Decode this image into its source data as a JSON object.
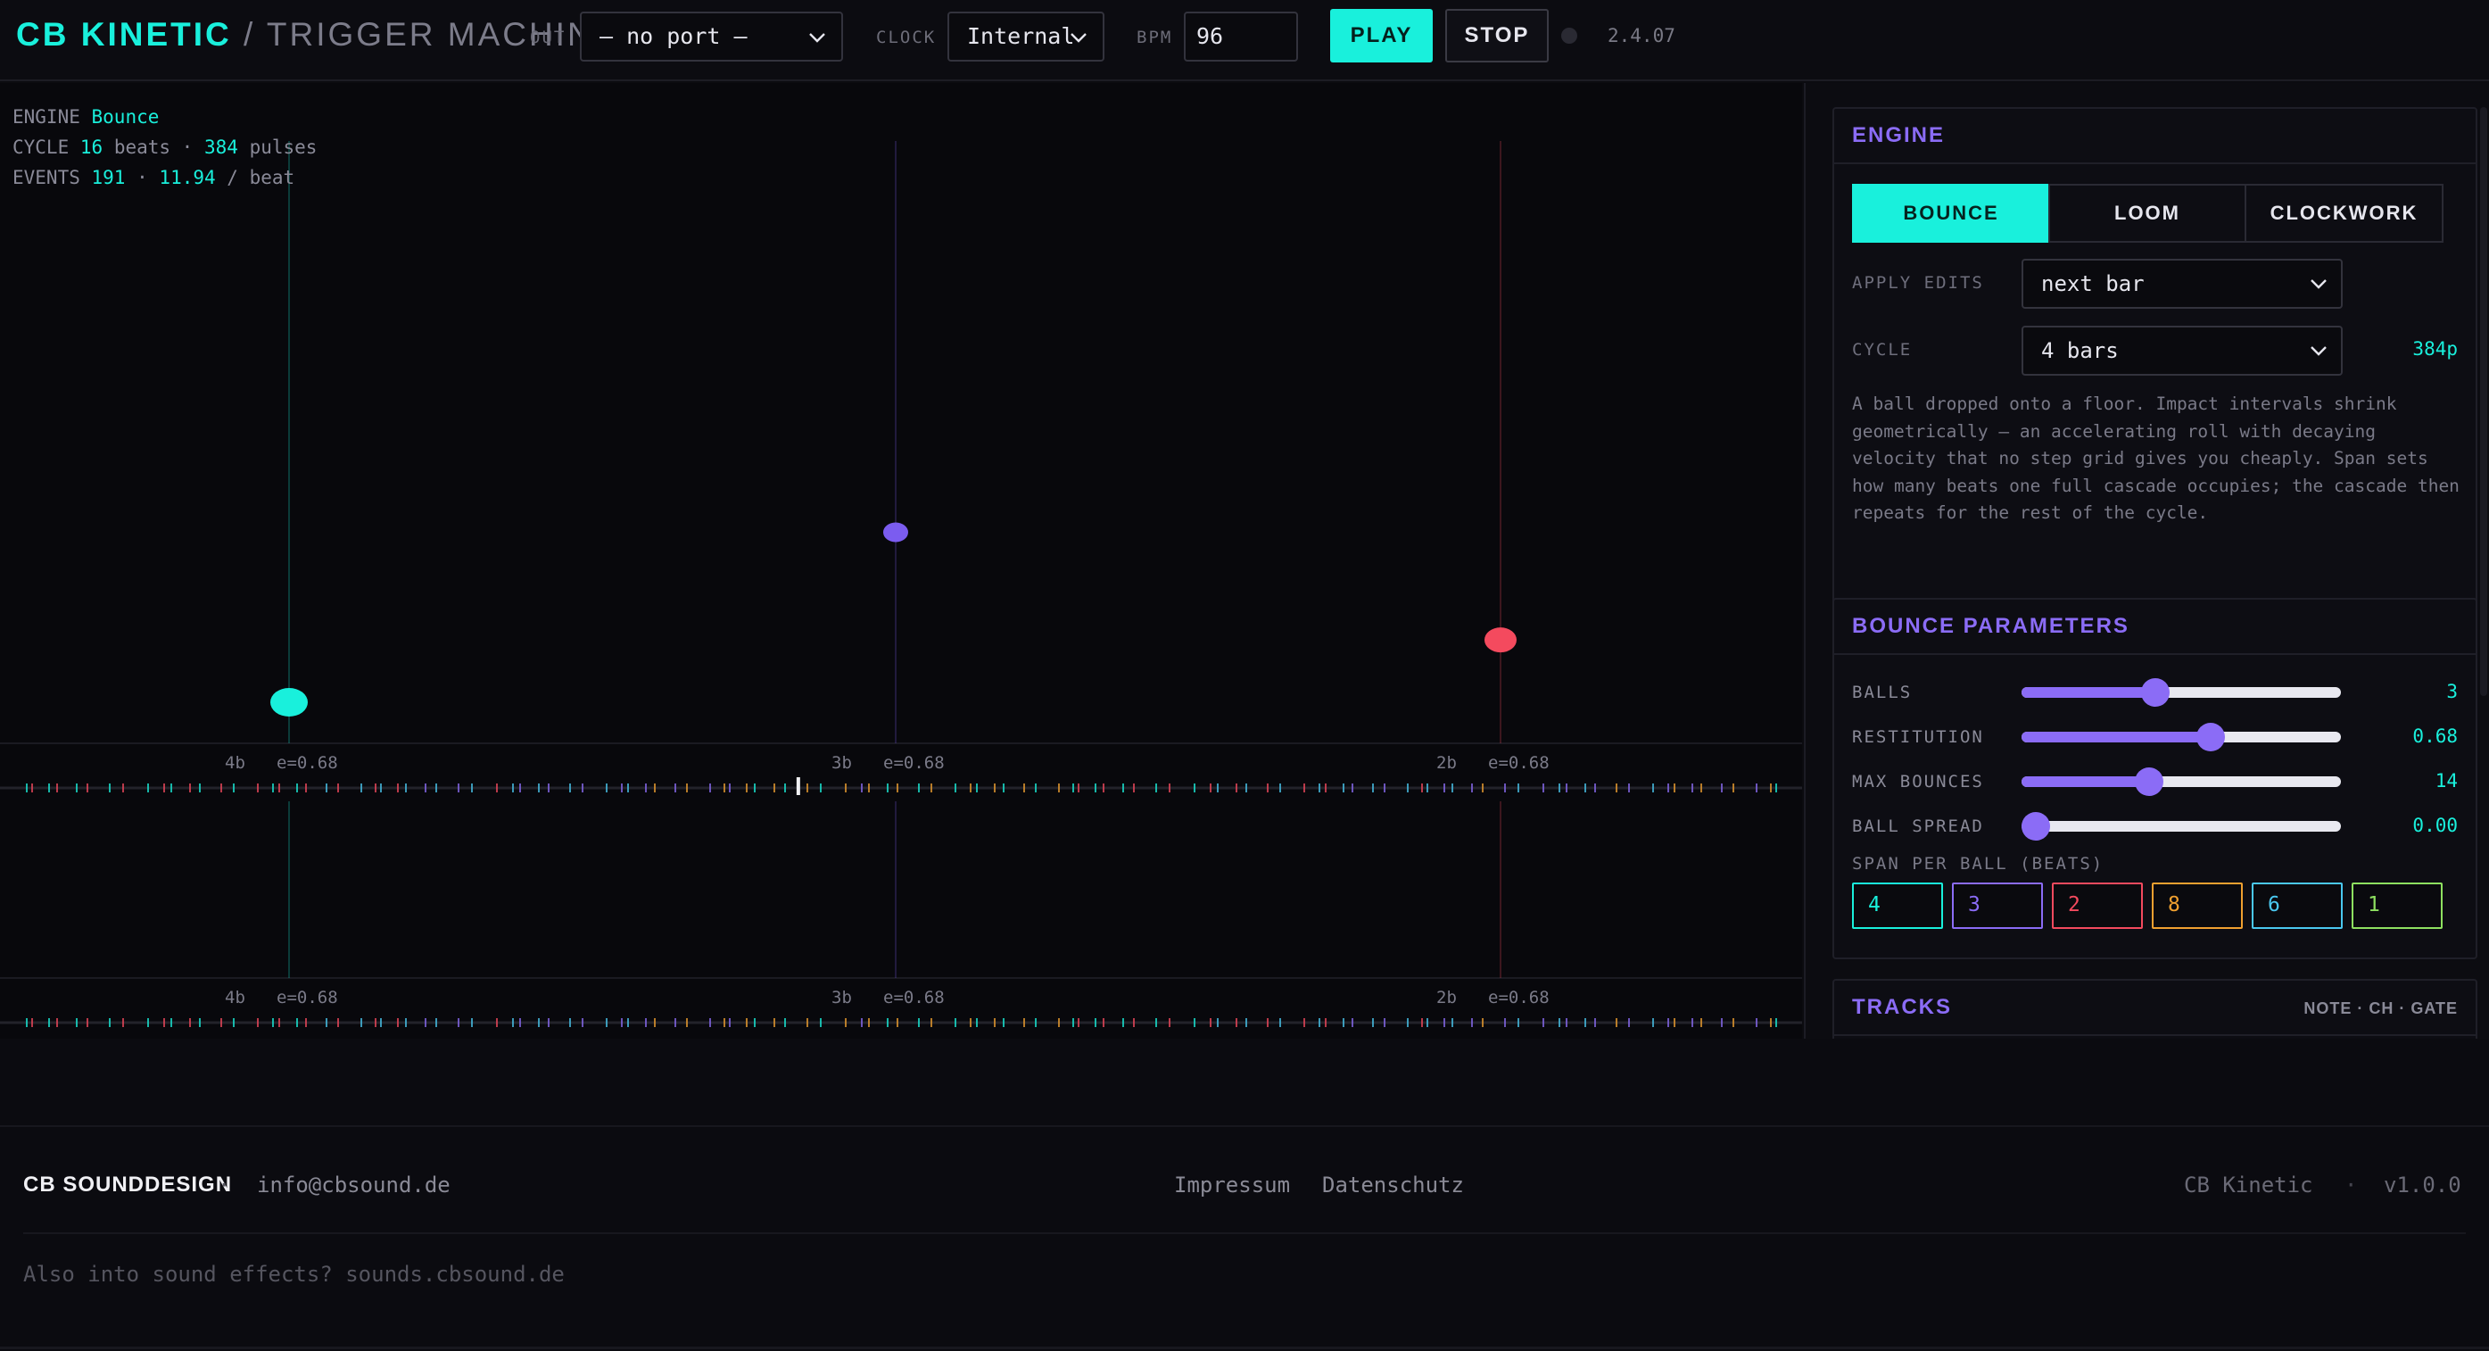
{
  "header": {
    "brand_primary": "CB KINETIC",
    "brand_secondary": "/ TRIGGER MACHINE",
    "out_label": "OUT",
    "out_value": "— no port —",
    "clock_label": "CLOCK",
    "clock_value": "Internal",
    "bpm_label": "BPM",
    "bpm_value": "96",
    "play_label": "PLAY",
    "stop_label": "STOP",
    "version": "2.4.07"
  },
  "stats": {
    "engine_label": "ENGINE",
    "engine_value": "Bounce",
    "cycle_label": "CYCLE",
    "cycle_beats": "16",
    "cycle_beats_unit": "beats ·",
    "cycle_pulses": "384",
    "cycle_pulses_unit": "pulses",
    "events_label": "EVENTS",
    "events_count": "191",
    "events_sep": "·",
    "events_rate": "11.94",
    "events_rate_unit": "/ beat"
  },
  "visualization": {
    "balls": [
      {
        "color": "#19f0dc",
        "height_level": 0.0,
        "label_span": "4b",
        "label_restitution": "e=0.68"
      },
      {
        "color": "#7b5cf0",
        "height_level": 0.3,
        "label_span": "3b",
        "label_restitution": "e=0.68"
      },
      {
        "color": "#f44a5e",
        "height_level": 0.11,
        "label_span": "2b",
        "label_restitution": "e=0.68"
      }
    ],
    "playhead_fraction": 0.443,
    "event_colors": [
      "#19f0dc",
      "#8b6cf6",
      "#f44a5e",
      "#f0a030",
      "#4ac8f0"
    ]
  },
  "engine_card": {
    "title": "ENGINE",
    "modes": [
      "BOUNCE",
      "LOOM",
      "CLOCKWORK"
    ],
    "active_mode": "BOUNCE",
    "apply_edits_label": "APPLY EDITS",
    "apply_edits_value": "next bar",
    "cycle_label": "CYCLE",
    "cycle_value": "4 bars",
    "cycle_pulses": "384p",
    "description": "A ball dropped onto a floor. Impact intervals shrink geometrically — an accelerating roll with decaying velocity that no step grid gives you cheaply. Span sets how many beats one full cascade occupies; the cascade then repeats for the rest of the cycle."
  },
  "bounce_card": {
    "title": "BOUNCE PARAMETERS",
    "params": [
      {
        "label": "BALLS",
        "value": "3",
        "fraction": 0.41
      },
      {
        "label": "RESTITUTION",
        "value": "0.68",
        "fraction": 0.6
      },
      {
        "label": "MAX BOUNCES",
        "value": "14",
        "fraction": 0.39
      },
      {
        "label": "BALL SPREAD",
        "value": "0.00",
        "fraction": 0.0
      }
    ],
    "span_label": "SPAN PER BALL (BEATS)",
    "spans": [
      {
        "value": "4",
        "color": "#19f0dc"
      },
      {
        "value": "3",
        "color": "#8b6cf6"
      },
      {
        "value": "2",
        "color": "#f44a5e"
      },
      {
        "value": "8",
        "color": "#f0a030"
      },
      {
        "value": "6",
        "color": "#4ac8f0"
      },
      {
        "value": "1",
        "color": "#8ee060"
      }
    ]
  },
  "tracks_card": {
    "title": "TRACKS",
    "columns": "NOTE · CH · GATE"
  },
  "footer": {
    "company": "CB SOUNDDESIGN",
    "sep": "·",
    "email": "info@cbsound.de",
    "impressum": "Impressum",
    "datenschutz": "Datenschutz",
    "product": "CB Kinetic",
    "sep2": "·",
    "product_version": "v1.0.0",
    "tagline": "Also into sound effects? sounds.cbsound.de"
  }
}
